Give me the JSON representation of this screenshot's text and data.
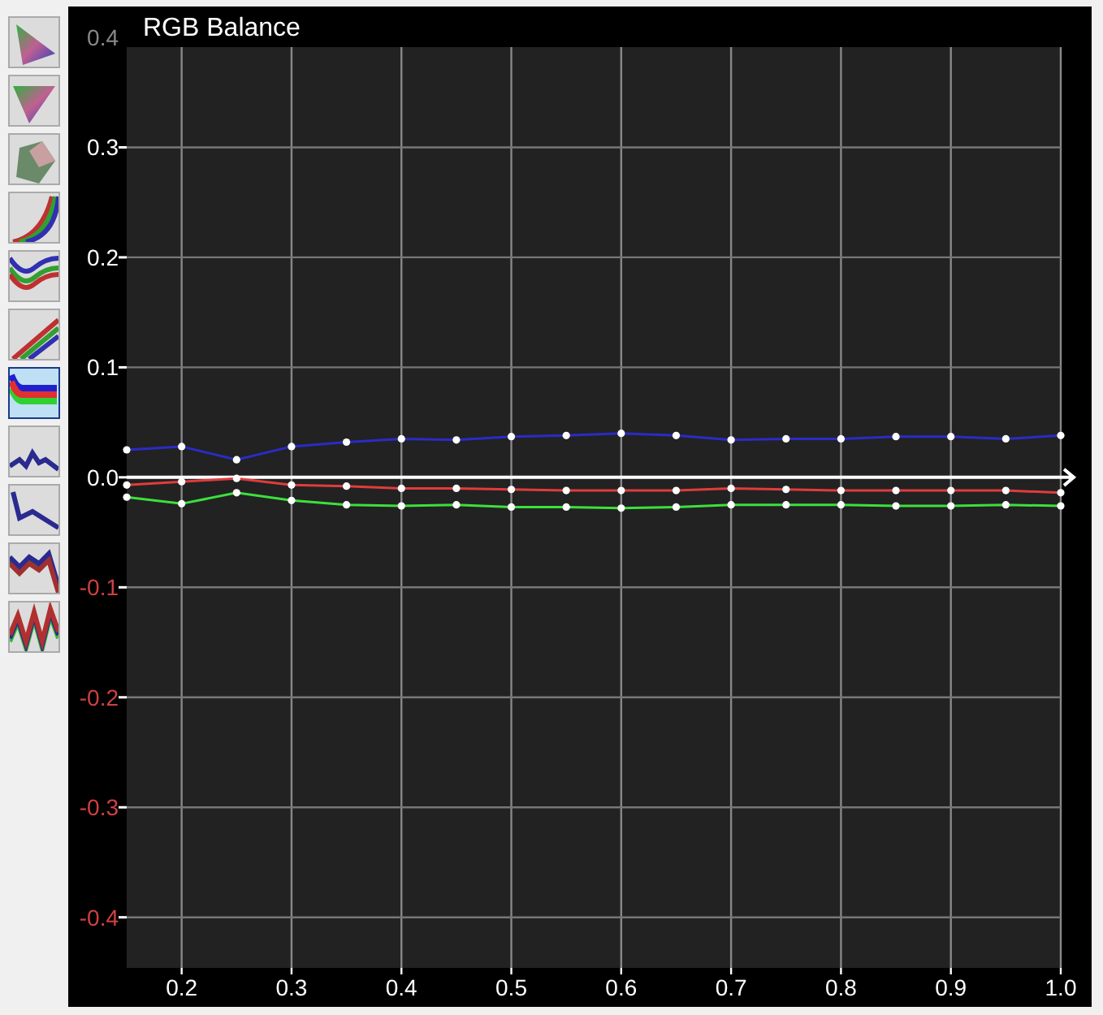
{
  "sidebar": {
    "items": [
      {
        "kind": "gamut-flat",
        "selected": false
      },
      {
        "kind": "gamut-flip",
        "selected": false
      },
      {
        "kind": "gamut-3d",
        "selected": false
      },
      {
        "kind": "curves",
        "selected": false
      },
      {
        "kind": "wave",
        "selected": false
      },
      {
        "kind": "diagonal",
        "selected": false
      },
      {
        "kind": "balance",
        "selected": true
      },
      {
        "kind": "zigzag",
        "selected": false
      },
      {
        "kind": "drop",
        "selected": false
      },
      {
        "kind": "jagged",
        "selected": false
      },
      {
        "kind": "noisy",
        "selected": false
      }
    ]
  },
  "chart": {
    "chart_data": {
      "type": "line",
      "title": "RGB Balance",
      "x": [
        0.15,
        0.2,
        0.25,
        0.3,
        0.35,
        0.4,
        0.45,
        0.5,
        0.55,
        0.6,
        0.65,
        0.7,
        0.75,
        0.8,
        0.85,
        0.9,
        0.95,
        1.0
      ],
      "series": [
        {
          "color": "#2b2bc8",
          "marker": "circle",
          "values": [
            0.025,
            0.028,
            0.016,
            0.028,
            0.032,
            0.035,
            0.034,
            0.037,
            0.038,
            0.04,
            0.038,
            0.034,
            0.035,
            0.035,
            0.037,
            0.037,
            0.035,
            0.038
          ]
        },
        {
          "color": "#e03c3c",
          "marker": "circle",
          "values": [
            -0.007,
            -0.004,
            -0.001,
            -0.007,
            -0.008,
            -0.01,
            -0.01,
            -0.011,
            -0.012,
            -0.012,
            -0.012,
            -0.01,
            -0.011,
            -0.012,
            -0.012,
            -0.012,
            -0.012,
            -0.014
          ]
        },
        {
          "color": "#3ce03c",
          "marker": "circle",
          "values": [
            -0.018,
            -0.024,
            -0.014,
            -0.021,
            -0.025,
            -0.026,
            -0.025,
            -0.027,
            -0.027,
            -0.028,
            -0.027,
            -0.025,
            -0.025,
            -0.025,
            -0.026,
            -0.026,
            -0.025,
            -0.026
          ]
        }
      ],
      "grid": true,
      "xlim": [
        0.15,
        1.0
      ],
      "ylim": [
        -0.446,
        0.4
      ],
      "xticks": [
        {
          "value": 0.2,
          "label": "0.2"
        },
        {
          "value": 0.3,
          "label": "0.3"
        },
        {
          "value": 0.4,
          "label": "0.4"
        },
        {
          "value": 0.5,
          "label": "0.5"
        },
        {
          "value": 0.6,
          "label": "0.6"
        },
        {
          "value": 0.7,
          "label": "0.7"
        },
        {
          "value": 0.8,
          "label": "0.8"
        },
        {
          "value": 0.9,
          "label": "0.9"
        },
        {
          "value": 1.0,
          "label": "1.0"
        }
      ],
      "yticks": [
        {
          "value": 0.4,
          "label": "0.4"
        },
        {
          "value": 0.3,
          "label": "0.3"
        },
        {
          "value": 0.2,
          "label": "0.2"
        },
        {
          "value": 0.1,
          "label": "0.1"
        },
        {
          "value": 0.0,
          "label": "0.0"
        },
        {
          "value": -0.1,
          "label": "-0.1"
        },
        {
          "value": -0.2,
          "label": "-0.2"
        },
        {
          "value": -0.3,
          "label": "-0.3"
        },
        {
          "value": -0.4,
          "label": "-0.4"
        }
      ]
    }
  }
}
